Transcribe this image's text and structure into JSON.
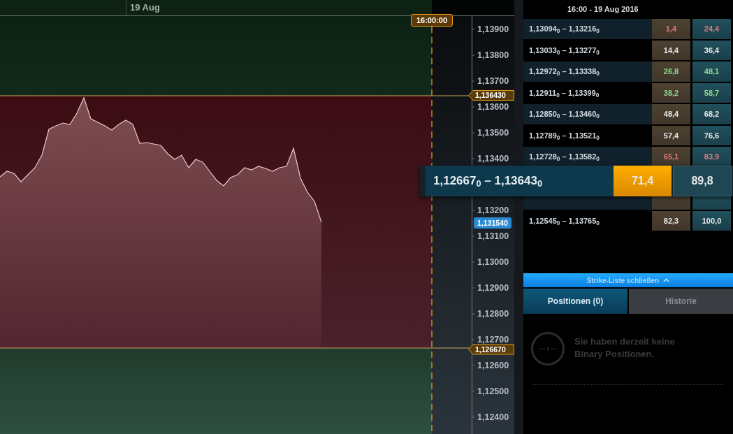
{
  "chart": {
    "date_label": "19 Aug",
    "expiry_time": "16:00:00",
    "upper_barrier": "1,136430",
    "lower_barrier": "1,126670",
    "current_price": "1,131540",
    "axis_labels": [
      {
        "kind": "tick",
        "label": "1,13900"
      },
      {
        "kind": "tick",
        "label": "1,13800"
      },
      {
        "kind": "tick",
        "label": "1,13700"
      },
      {
        "kind": "tick",
        "label": "1,13600"
      },
      {
        "kind": "tick",
        "label": "1,13500"
      },
      {
        "kind": "tick",
        "label": "1,13400"
      },
      {
        "kind": "covered"
      },
      {
        "kind": "tick",
        "label": "1,13200"
      },
      {
        "kind": "tick",
        "label": "1,13100"
      },
      {
        "kind": "tick",
        "label": "1,13000"
      },
      {
        "kind": "tick",
        "label": "1,12900"
      },
      {
        "kind": "tick",
        "label": "1,12800"
      },
      {
        "kind": "tick",
        "label": "1,12700"
      },
      {
        "kind": "tick",
        "label": "1,12600"
      },
      {
        "kind": "tick",
        "label": "1,12500"
      },
      {
        "kind": "tick",
        "label": "1,12400"
      }
    ]
  },
  "strike_panel": {
    "title": "16:00 - 19 Aug 2016",
    "strikes": [
      {
        "kind": "row",
        "range": "1,13094$_{0}$ – 1,13216$_{0}$",
        "call": "1,4",
        "put": "24,4",
        "rising": false,
        "falling": true,
        "selected": false
      },
      {
        "kind": "row",
        "range": "1,13033$_{0}$ – 1,13277$_{0}$",
        "call": "14,4",
        "put": "36,4",
        "rising": false,
        "falling": false,
        "selected": false
      },
      {
        "kind": "row",
        "range": "1,12972$_{0}$ – 1,13338$_{0}$",
        "call": "26,8",
        "put": "48,1",
        "rising": true,
        "falling": false,
        "selected": false
      },
      {
        "kind": "row",
        "range": "1,12911$_{0}$ – 1,13399$_{0}$",
        "call": "38,2",
        "put": "58,7",
        "rising": true,
        "falling": false,
        "selected": false
      },
      {
        "kind": "row",
        "range": "1,12850$_{0}$ – 1,13460$_{0}$",
        "call": "48,4",
        "put": "68,2",
        "rising": false,
        "falling": false,
        "selected": false
      },
      {
        "kind": "row",
        "range": "1,12789$_{0}$ – 1,13521$_{0}$",
        "call": "57,4",
        "put": "76,6",
        "rising": false,
        "falling": false,
        "selected": false
      },
      {
        "kind": "row",
        "range": "1,12728$_{0}$ – 1,13582$_{0}$",
        "call": "65,1",
        "put": "83,9",
        "rising": false,
        "falling": true,
        "selected": false
      },
      {
        "kind": "row",
        "range": "1,12667$_{0}$ – 1,13643$_{0}$",
        "call": "71,4",
        "put": "89,8",
        "rising": false,
        "falling": false,
        "selected": true
      },
      {
        "kind": "covered",
        "selected": false
      },
      {
        "kind": "row",
        "range": "1,12545$_{0}$ – 1,13765$_{0}$",
        "call": "82,3",
        "put": "100,0",
        "rising": false,
        "falling": false,
        "selected": false
      }
    ]
  },
  "close_strikes_button": {
    "label": "Strike-Liste schließen"
  },
  "tabs": [
    {
      "label": "Positionen (0)",
      "selected": true
    },
    {
      "label": "Historie",
      "selected": false
    }
  ],
  "empty_state": {
    "message": "Sie haben derzeit keine Binary Positionen."
  }
}
